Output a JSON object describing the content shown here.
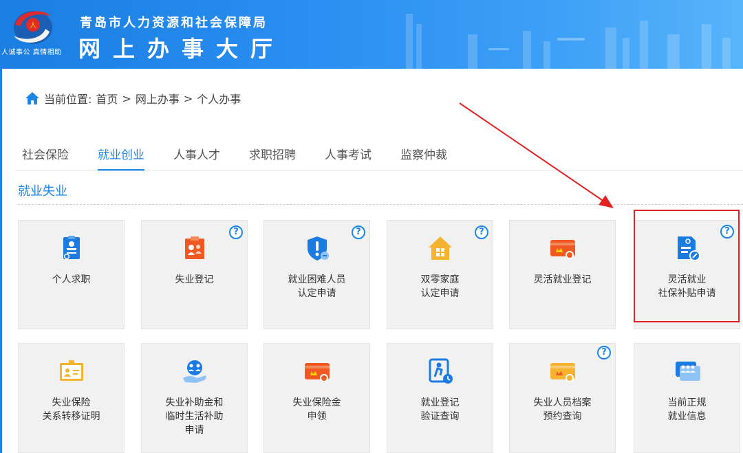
{
  "header": {
    "org_name": "青岛市人力资源和社会保障局",
    "hall_name": "网上办事大厅",
    "slogan": "人诚事公 真情相助"
  },
  "breadcrumb": {
    "prefix": "当前位置:",
    "items": [
      "首页",
      "网上办事",
      "个人办事"
    ],
    "separator": ">"
  },
  "tabs": [
    {
      "label": "社会保险",
      "active": false
    },
    {
      "label": "就业创业",
      "active": true
    },
    {
      "label": "人事人才",
      "active": false
    },
    {
      "label": "求职招聘",
      "active": false
    },
    {
      "label": "人事考试",
      "active": false
    },
    {
      "label": "监察仲裁",
      "active": false
    }
  ],
  "section": {
    "title": "就业失业"
  },
  "help_symbol": "?",
  "cards": [
    {
      "label": "个人求职",
      "icon": "job-seeking-icon",
      "help": false
    },
    {
      "label": "失业登记",
      "icon": "unemployment-registration-icon",
      "help": true
    },
    {
      "label": "就业困难人员\n认定申请",
      "icon": "shield-icon",
      "help": true
    },
    {
      "label": "双零家庭\n认定申请",
      "icon": "house-icon",
      "help": true
    },
    {
      "label": "灵活就业登记",
      "icon": "card-icon",
      "help": false
    },
    {
      "label": "灵活就业\n社保补贴申请",
      "icon": "document-edit-icon",
      "help": true,
      "highlighted": true
    },
    {
      "label": "失业保险\n关系转移证明",
      "icon": "certificate-icon",
      "help": false
    },
    {
      "label": "失业补助金和\n临时生活补助\n申请",
      "icon": "hand-people-icon",
      "help": false
    },
    {
      "label": "失业保险金\n申领",
      "icon": "card-icon",
      "help": false
    },
    {
      "label": "就业登记\n验证查询",
      "icon": "person-clock-icon",
      "help": false
    },
    {
      "label": "失业人员档案\n预约查询",
      "icon": "card-icon",
      "help": true
    },
    {
      "label": "当前正规\n就业信息",
      "icon": "people-chat-icon",
      "help": false
    }
  ],
  "colors": {
    "accent": "#1b86e8",
    "highlight": "#e22222",
    "icon_blue": "#1b7be0",
    "icon_orange": "#f05a22",
    "icon_yellow": "#f5b330"
  }
}
